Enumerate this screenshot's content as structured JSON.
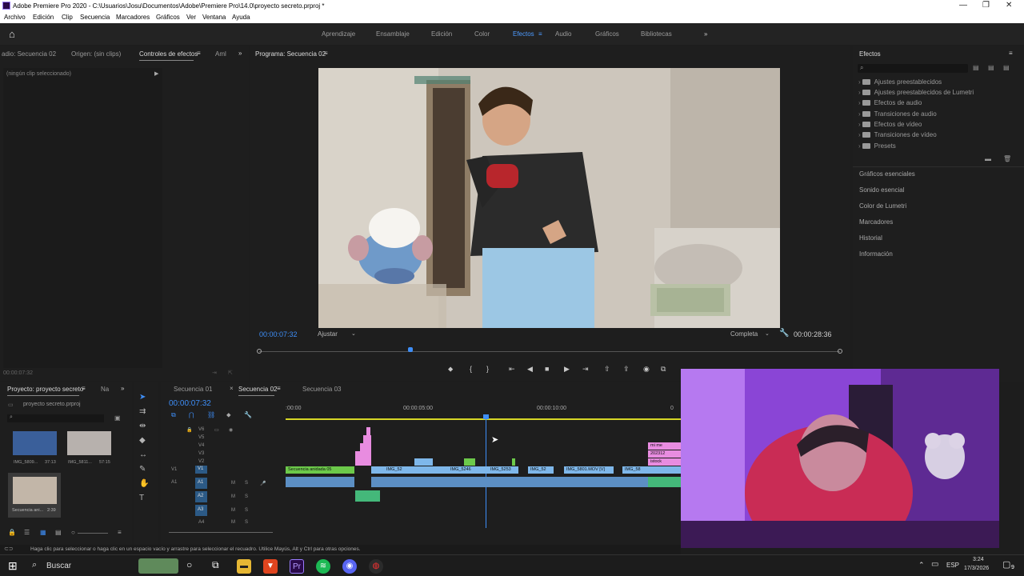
{
  "window": {
    "title": "Adobe Premiere Pro 2020 - C:\\Usuarios\\Josu\\Documentos\\Adobe\\Premiere Pro\\14.0\\proyecto secreto.prproj *"
  },
  "menu": [
    "Archivo",
    "Edición",
    "Clip",
    "Secuencia",
    "Marcadores",
    "Gráficos",
    "Ver",
    "Ventana",
    "Ayuda"
  ],
  "workspaces": [
    {
      "label": "Aprendizaje"
    },
    {
      "label": "Ensamblaje"
    },
    {
      "label": "Edición"
    },
    {
      "label": "Color"
    },
    {
      "label": "Efectos"
    },
    {
      "label": "Audio"
    },
    {
      "label": "Gráficos"
    },
    {
      "label": "Bibliotecas"
    }
  ],
  "workspaces_more": "»",
  "source_panel": {
    "tabs": [
      "adio: Secuencia 02",
      "Origen: (sin clips)",
      "Controles de efectos",
      "Aml"
    ],
    "no_clip": "(ningún clip seleccionado)",
    "timecode": "00:00:07:32"
  },
  "program": {
    "title": "Programa: Secuencia 02",
    "timecode": "00:00:07:32",
    "fit": "Ajustar",
    "quality": "Completa",
    "duration": "00:00:28:36",
    "playhead_fraction": 0.261
  },
  "effects_panel": {
    "title": "Efectos",
    "items": [
      "Ajustes preestablecidos",
      "Ajustes preestablecidos de Lumetri",
      "Efectos de audio",
      "Transiciones de audio",
      "Efectos de vídeo",
      "Transiciones de vídeo",
      "Presets"
    ],
    "sections": [
      "Gráficos esenciales",
      "Sonido esencial",
      "Color de Lumetri",
      "Marcadores",
      "Historial",
      "Información"
    ]
  },
  "project_panel": {
    "tabs": [
      "Proyecto: proyecto secreto",
      "Na"
    ],
    "file": "proyecto secreto.prproj",
    "bins": [
      {
        "name": "IMG_5809...",
        "dur": "37:13"
      },
      {
        "name": "IMG_5811...",
        "dur": "57:15"
      },
      {
        "name": "Secuencia ani...",
        "dur": "2:39"
      }
    ]
  },
  "timeline": {
    "tabs": [
      "Secuencia 01",
      "Secuencia 02",
      "Secuencia 03"
    ],
    "timecode": "00:00:07:32",
    "ruler": [
      ":00:00",
      "00:00:05:00",
      "00:00:10:00"
    ],
    "video_tracks": [
      "V6",
      "V5",
      "V4",
      "V3",
      "V2",
      "V1"
    ],
    "audio_tracks": [
      "A1",
      "A2",
      "A3",
      "A4"
    ],
    "targets": {
      "v1": "V1",
      "a1": "A1",
      "a1_source": "A1"
    },
    "ms": {
      "m": "M",
      "s": "S"
    },
    "clips_v1": [
      {
        "label": "Secuencia anidada 05",
        "color": "#6cc94a"
      },
      {
        "label": "IMG_52",
        "color": "#7eb7ea"
      },
      {
        "label": "IMG_5246",
        "color": "#7eb7ea"
      },
      {
        "label": "IMG_5253",
        "color": "#7eb7ea"
      },
      {
        "label": "IMG_52",
        "color": "#7eb7ea"
      },
      {
        "label": "IMG_5801.MOV [V]",
        "color": "#7eb7ea"
      },
      {
        "label": "IMG_58",
        "color": "#7eb7ea"
      }
    ],
    "clips_upper": [
      {
        "label": "mi me",
        "color": "#e88ce0"
      },
      {
        "label": "202312",
        "color": "#e88ce0"
      },
      {
        "label": "istock",
        "color": "#e88ce0"
      }
    ]
  },
  "status": {
    "hint": "Haga clic para seleccionar o haga clic en un espacio vacío y arrastre para seleccionar el recuadro. Utilice Mayús, Alt y Ctrl para otras opciones."
  },
  "taskbar": {
    "search": "Buscar",
    "lang": "ESP",
    "time": "3:24",
    "date": "17/3/2026",
    "notif": "9"
  }
}
